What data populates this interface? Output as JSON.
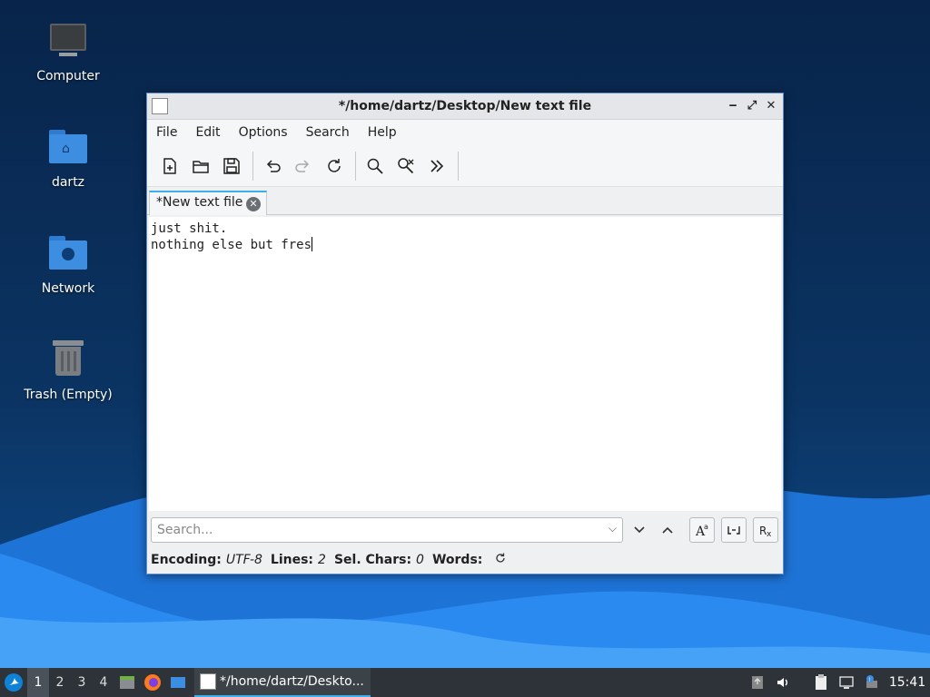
{
  "desktop": {
    "icons": [
      {
        "label": "Computer",
        "icon": "computer-icon"
      },
      {
        "label": "dartz",
        "icon": "home-folder-icon"
      },
      {
        "label": "Network",
        "icon": "network-folder-icon"
      },
      {
        "label": "Trash (Empty)",
        "icon": "trash-icon"
      }
    ]
  },
  "window": {
    "title": "*/home/dartz/Desktop/New text file",
    "buttons": {
      "minimize": "‒",
      "maximize": "⤢",
      "close": "✕"
    },
    "menu": [
      "File",
      "Edit",
      "Options",
      "Search",
      "Help"
    ],
    "toolbar": [
      "new-document-icon",
      "open-file-icon",
      "save-icon",
      "undo-icon",
      "redo-icon",
      "reload-icon",
      "find-icon",
      "find-replace-icon",
      "more-icon"
    ],
    "tab": {
      "label": "*New text file",
      "close": "✕"
    },
    "editor": {
      "lines": [
        "just shit.",
        "nothing else but fres"
      ]
    },
    "search": {
      "placeholder": "Search..."
    },
    "status": {
      "encoding_label": "Encoding:",
      "encoding_value": "UTF-8",
      "lines_label": "Lines:",
      "lines_value": "2",
      "sel_label": "Sel. Chars:",
      "sel_value": "0",
      "words_label": "Words:"
    }
  },
  "taskbar": {
    "workspaces": [
      "1",
      "2",
      "3",
      "4"
    ],
    "active_workspace": "1",
    "task_label": "*/home/dartz/Deskto...",
    "clock": "15:41"
  },
  "colors": {
    "accent": "#3daee9",
    "taskbar": "#2d3338",
    "folder": "#3d8ee0"
  }
}
